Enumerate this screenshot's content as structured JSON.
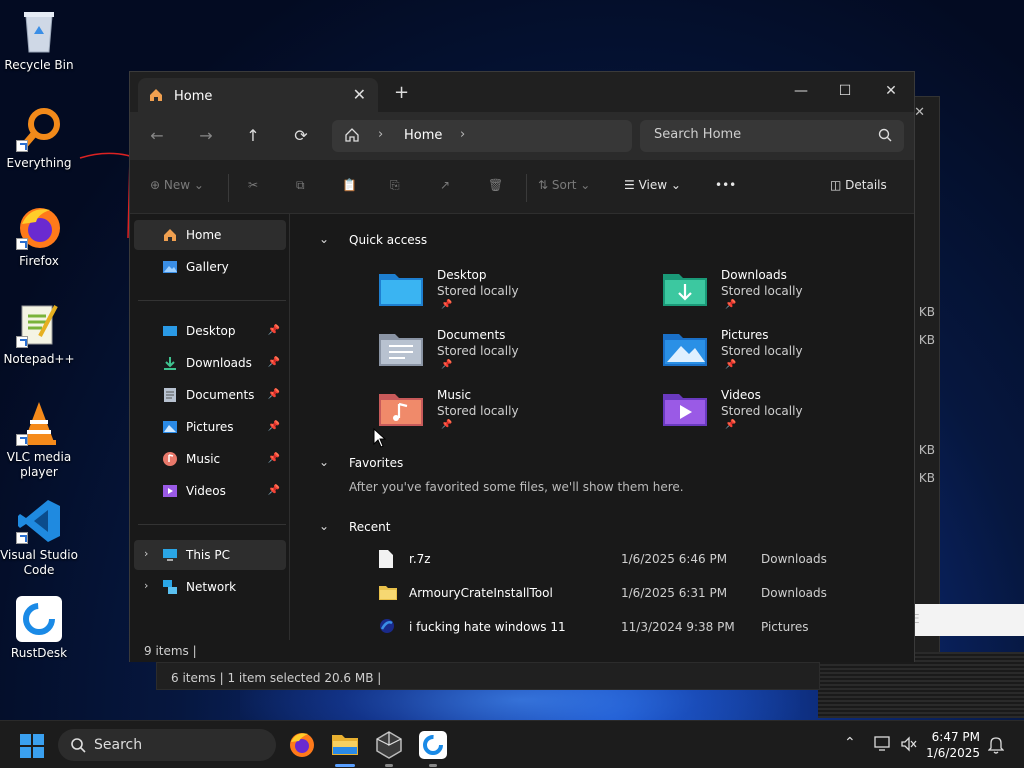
{
  "desktop": {
    "icons": [
      {
        "label": "Recycle Bin"
      },
      {
        "label": "Everything"
      },
      {
        "label": "Firefox"
      },
      {
        "label": "Notepad++"
      },
      {
        "label": "VLC media player"
      },
      {
        "label": "Visual Studio Code"
      },
      {
        "label": "RustDesk"
      }
    ]
  },
  "back_window": {
    "status": "6 items  |  1 item selected  20.6 MB  |",
    "sizes": [
      "KB",
      "KB",
      "KB",
      "KB"
    ],
    "strip_text": "E"
  },
  "explorer": {
    "tab_title": "Home",
    "new_tab": "+",
    "window_controls": {
      "minimize": "—",
      "maximize": "☐",
      "close": "✕"
    },
    "breadcrumb": {
      "location": "Home"
    },
    "search_placeholder": "Search Home",
    "toolbar": {
      "new": "New",
      "sort": "Sort",
      "view": "View",
      "more": "•••",
      "details": "Details"
    },
    "nav": {
      "home": "Home",
      "gallery": "Gallery",
      "pinned": [
        {
          "label": "Desktop"
        },
        {
          "label": "Downloads"
        },
        {
          "label": "Documents"
        },
        {
          "label": "Pictures"
        },
        {
          "label": "Music"
        },
        {
          "label": "Videos"
        }
      ],
      "this_pc": "This PC",
      "network": "Network"
    },
    "sections": {
      "quick_access": "Quick access",
      "favorites": "Favorites",
      "recent": "Recent"
    },
    "quick_access": [
      {
        "name": "Desktop",
        "status": "Stored locally"
      },
      {
        "name": "Downloads",
        "status": "Stored locally"
      },
      {
        "name": "Documents",
        "status": "Stored locally"
      },
      {
        "name": "Pictures",
        "status": "Stored locally"
      },
      {
        "name": "Music",
        "status": "Stored locally"
      },
      {
        "name": "Videos",
        "status": "Stored locally"
      }
    ],
    "favorites_empty": "After you've favorited some files, we'll show them here.",
    "recent": [
      {
        "name": "r.7z",
        "date": "1/6/2025 6:46 PM",
        "location": "Downloads"
      },
      {
        "name": "ArmouryCrateInstallTool",
        "date": "1/6/2025 6:31 PM",
        "location": "Downloads"
      },
      {
        "name": "i fucking hate windows 11",
        "date": "11/3/2024 9:38 PM",
        "location": "Pictures"
      }
    ],
    "status": "9 items  |"
  },
  "taskbar": {
    "search_label": "Search",
    "time": "6:47 PM",
    "date": "1/6/2025"
  }
}
